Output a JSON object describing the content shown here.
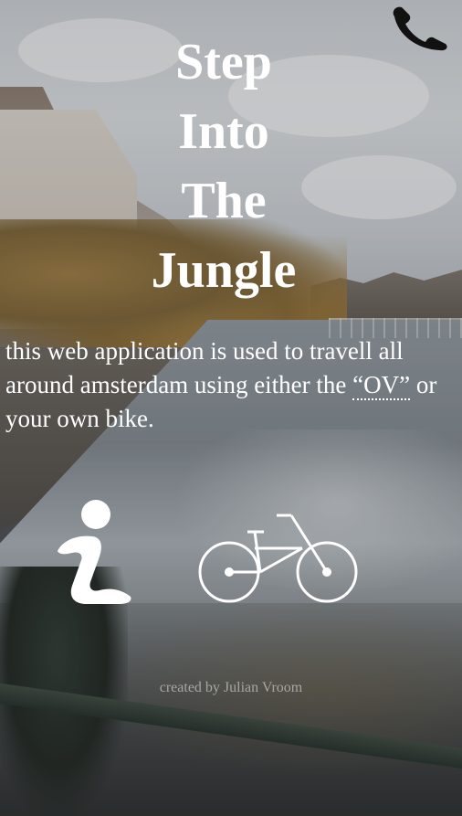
{
  "title": {
    "lines": [
      "Step",
      "Into",
      "The",
      "Jungle"
    ]
  },
  "description": {
    "before_abbr": "this web application is used to travell all around amsterdam using either the ",
    "abbr": "“OV”",
    "after_abbr": " or your own bike."
  },
  "icons": {
    "phone": "phone-icon",
    "info": "info-icon",
    "bike": "bike-icon"
  },
  "footer": {
    "credit": "created by Julian Vroom"
  },
  "colors": {
    "text": "#ffffff",
    "footer_text": "#a6a6a6",
    "phone_icon": "#111111"
  }
}
